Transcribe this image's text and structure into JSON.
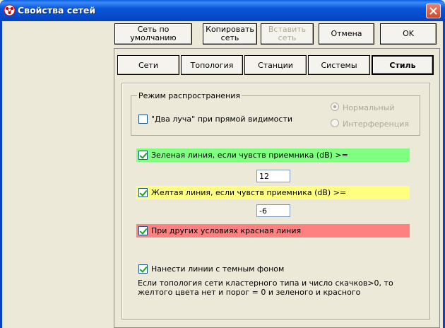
{
  "window": {
    "title": "Свойства сетей"
  },
  "toolbar": {
    "default_label": "Сеть по умолчанию",
    "copy_label": "Копировать сеть",
    "paste_label": "Вставить сеть",
    "cancel_label": "Отмена",
    "ok_label": "OK"
  },
  "tabs": [
    {
      "label": "Сети"
    },
    {
      "label": "Топология"
    },
    {
      "label": "Станции"
    },
    {
      "label": "Системы"
    },
    {
      "label": "Стиль",
      "active": true
    }
  ],
  "propagation": {
    "legend": "Режим распространения",
    "two_ray_label": "\"Два луча\" при прямой видимости",
    "two_ray_checked": false,
    "normal_label": "Нормальный",
    "interference_label": "Интерференция",
    "selected": "normal"
  },
  "lines": {
    "green": {
      "label": "Зеленая линия, если чувств приемника (dB) >=",
      "checked": true,
      "value": "12",
      "color": "#80ff80"
    },
    "yellow": {
      "label": "Желтая линия, если чувств приемника (dB) >=",
      "checked": true,
      "value": "-6",
      "color": "#ffff80"
    },
    "red": {
      "label": "При других условиях красная линия",
      "checked": true,
      "color": "#ff8080"
    }
  },
  "dark_bg": {
    "label": "Нанести линии с темным фоном",
    "checked": true
  },
  "note": "Если топология сети кластерного типа и число скачков>0, то желтого  цвета нет и порог = 0 и зеленого и красного"
}
